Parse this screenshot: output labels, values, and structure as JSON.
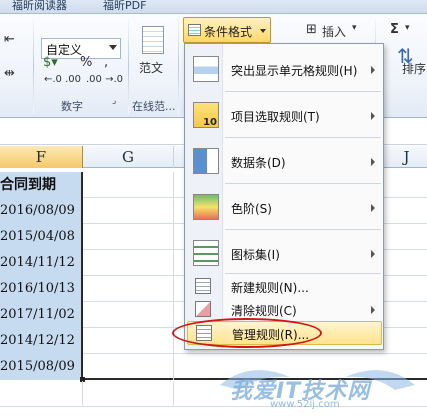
{
  "tabs": [
    "福昕阅读器",
    "福昕PDF"
  ],
  "ribbon": {
    "number_format": "自定义",
    "percent_symbol": "%",
    "comma_symbol": ",",
    "currency_symbol": "",
    "dec_increase": "←.0 .00",
    "dec_decrease": ".00 →.0",
    "number_group_label": "数字",
    "style_big_label": "范文",
    "style_group_label": "在线范...",
    "cf_button_label": "条件格式",
    "insert_label": "插入",
    "sort_label": "排序",
    "sigma": "Σ"
  },
  "columns": {
    "f": "F",
    "g": "G",
    "j": "J"
  },
  "sheet": {
    "header": "合同到期",
    "dates": [
      "2016/08/09",
      "2015/04/08",
      "2014/11/12",
      "2016/10/13",
      "2017/11/02",
      "2014/12/12",
      "2015/08/09"
    ]
  },
  "menu": {
    "items": [
      {
        "label": "突出显示单元格规则(H)",
        "submenu": true
      },
      {
        "label": "项目选取规则(T)",
        "submenu": true
      },
      {
        "label": "数据条(D)",
        "submenu": true
      },
      {
        "label": "色阶(S)",
        "submenu": true
      },
      {
        "label": "图标集(I)",
        "submenu": true
      }
    ],
    "new_rule": "新建规则(N)...",
    "clear_rule": "清除规则(C)",
    "manage_rule": "管理规则(R)..."
  },
  "watermark": {
    "text": "我爱IT技术网",
    "url": "www.52ij.com"
  },
  "colors": {
    "highlight": "#ffe38f",
    "selection": "#c6daf0",
    "annotation": "#d01818"
  }
}
